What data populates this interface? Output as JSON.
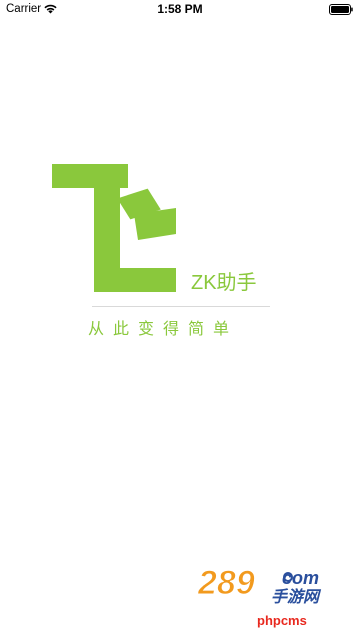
{
  "status_bar": {
    "carrier": "Carrier",
    "time": "1:58 PM",
    "wifi_icon": "wifi-icon",
    "battery_icon": "battery-icon"
  },
  "splash": {
    "app_name": "ZK助手",
    "tagline": "从此变得简单",
    "logo_icon": "fei-logo-icon",
    "accent_color": "#8ac83c"
  },
  "watermark": {
    "brand": "289",
    "brand_suffix": "com",
    "subtitle": "手游网",
    "site": "phpcms"
  }
}
